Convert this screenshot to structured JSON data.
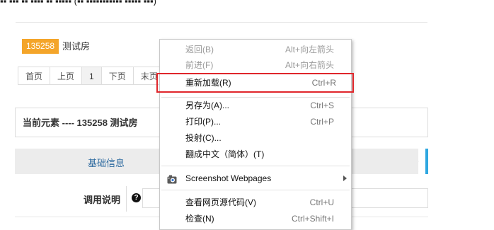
{
  "page": {
    "top_cut_text": "▪▪ ▪▪▪   ▪▪ ▪▪▪▪   ▪▪ ▪▪▪▪▪ (▪▪ ▪▪▪▪▪▪▪▪▪▪▪ ▪▪▪▪▪ ▪▪▪)",
    "room_id": "135258",
    "room_name": "测试房",
    "pager": [
      "首页",
      "上页",
      "1",
      "下页",
      "末页"
    ],
    "panel_title": "当前元素 ---- 135258 测试房",
    "tab_label": "基础信息",
    "field_label": "调用说明",
    "help_icon": "?"
  },
  "context_menu": {
    "items": [
      {
        "label": "返回(B)",
        "shortcut": "Alt+向左箭头",
        "enabled": false
      },
      {
        "label": "前进(F)",
        "shortcut": "Alt+向右箭头",
        "enabled": false
      },
      {
        "label": "重新加载(R)",
        "shortcut": "Ctrl+R",
        "enabled": true,
        "highlighted": true
      },
      {
        "label": "另存为(A)...",
        "shortcut": "Ctrl+S",
        "enabled": true
      },
      {
        "label": "打印(P)...",
        "shortcut": "Ctrl+P",
        "enabled": true
      },
      {
        "label": "投射(C)...",
        "shortcut": "",
        "enabled": true
      },
      {
        "label": "翻成中文（简体）(T)",
        "shortcut": "",
        "enabled": true
      },
      {
        "label": "Screenshot Webpages",
        "shortcut": "",
        "enabled": true,
        "submenu": true,
        "icon": "camera-icon"
      },
      {
        "label": "查看网页源代码(V)",
        "shortcut": "Ctrl+U",
        "enabled": true
      },
      {
        "label": "检查(N)",
        "shortcut": "Ctrl+Shift+I",
        "enabled": true
      }
    ]
  },
  "colors": {
    "room_badge": "#f4a52a",
    "highlight_box": "#e0262b",
    "tab_accent": "#2ea7e0",
    "tab_text": "#2d6a9f"
  }
}
